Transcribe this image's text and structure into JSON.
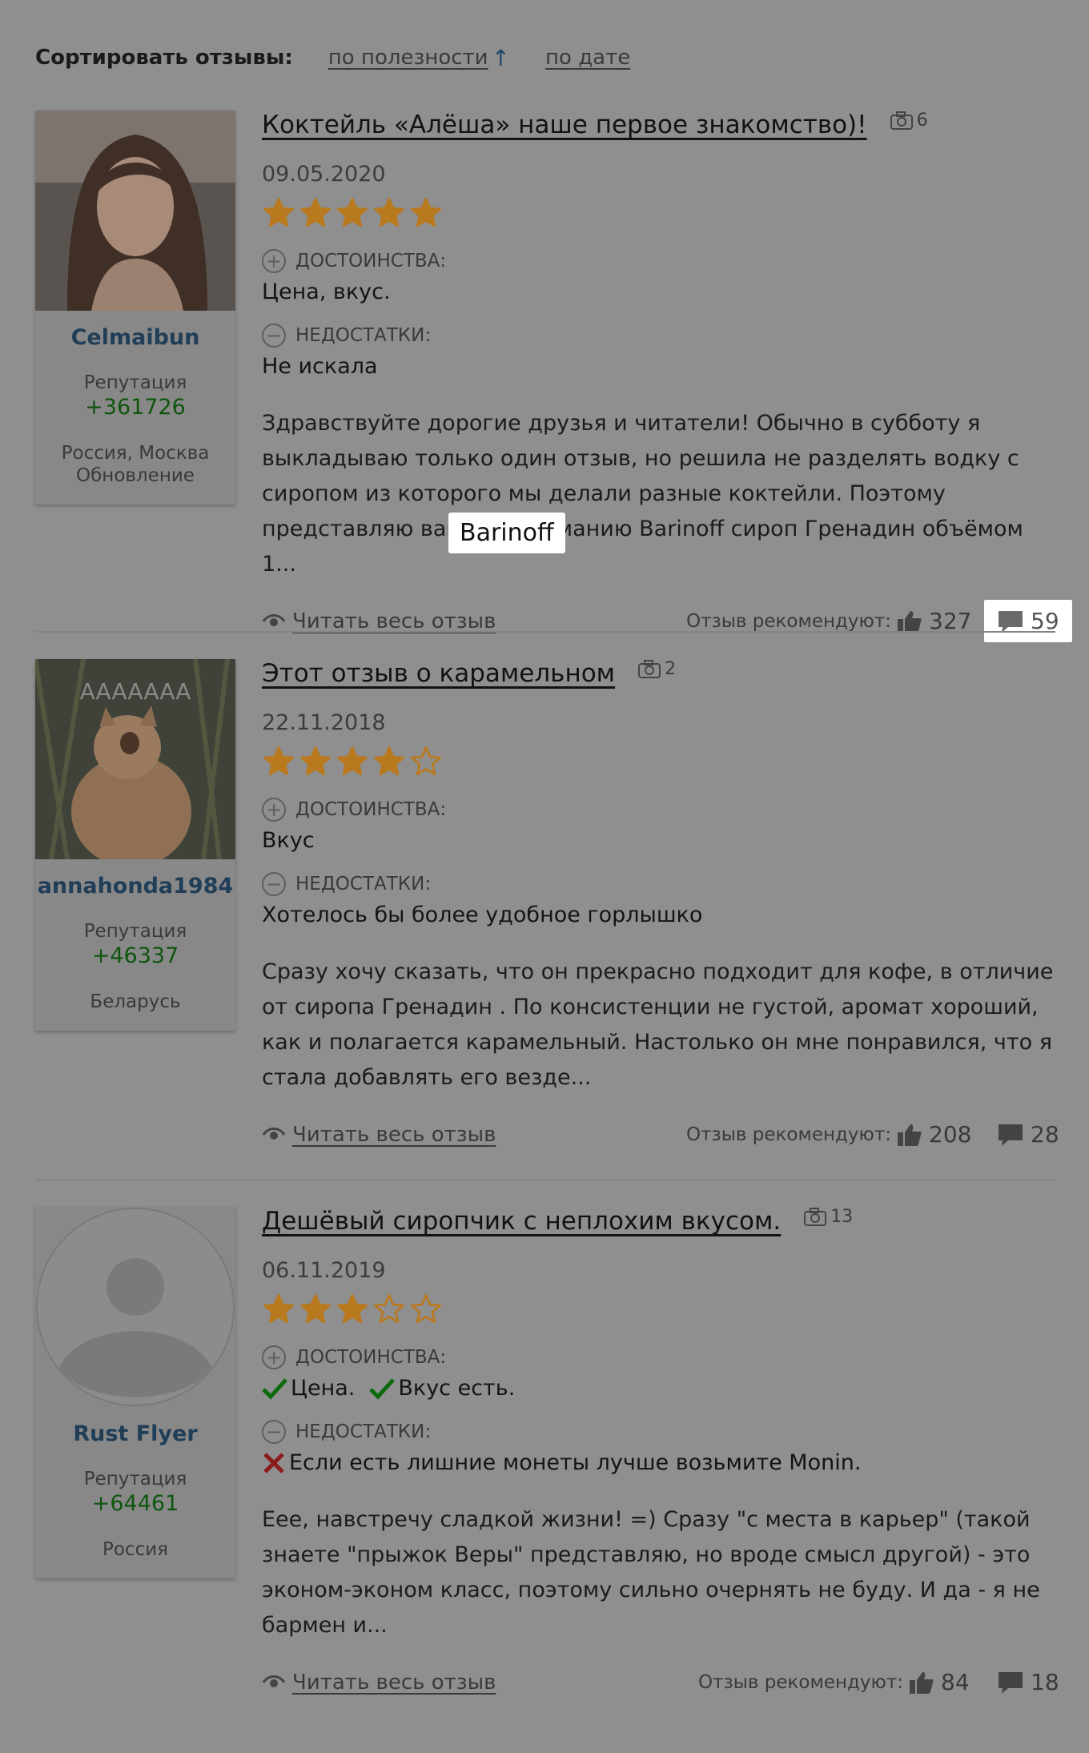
{
  "sort": {
    "label": "Сортировать отзывы:",
    "by_usefulness": "по полезности",
    "by_usefulness_arrow": "↑",
    "by_date": "по дате"
  },
  "tooltip": "Barinoff",
  "labels": {
    "pros": "ДОСТОИНСТВА:",
    "cons": "НЕДОСТАТКИ:",
    "read_more": "Читать весь отзыв",
    "recommend": "Отзыв рекомендуют:",
    "reputation": "Репутация"
  },
  "reviews": [
    {
      "user": {
        "name": "Celmaibun",
        "reputation": "+361726",
        "location": "Россия, Москва",
        "location_extra": "Обновление"
      },
      "title": "Коктейль «Алёша» наше первое знакомство)!",
      "photos": "6",
      "date": "09.05.2020",
      "rating": 5,
      "pros": "Цена, вкус.",
      "cons": "Не искала",
      "body": "Здравствуйте дорогие друзья и читатели! Обычно в субботу я выкладываю только один отзыв, но решила не разделять водку с сиропом из которого мы делали разные коктейли. Поэтому представляю вашему вниманию Barinoff сироп Гренадин объёмом 1...",
      "likes": "327",
      "comments": "59"
    },
    {
      "user": {
        "name": "annahonda1984",
        "reputation": "+46337",
        "location": "Беларусь"
      },
      "title": "Этот отзыв о карамельном",
      "photos": "2",
      "date": "22.11.2018",
      "rating": 4,
      "pros": "Вкус",
      "cons": "Хотелось бы более удобное горлышко",
      "body": "Сразу хочу сказать, что он прекрасно подходит для кофе, в отличие от сиропа Гренадин . По консистенции не густой, аромат хороший, как и полагается карамельный. Настолько он мне понравился, что я стала добавлять его везде...",
      "likes": "208",
      "comments": "28"
    },
    {
      "user": {
        "name": "Rust Flyer",
        "reputation": "+64461",
        "location": "Россия"
      },
      "title": "Дешёвый сиропчик с неплохим вкусом.",
      "photos": "13",
      "date": "06.11.2019",
      "rating": 3,
      "pros_items": [
        "Цена.",
        "Вкус есть."
      ],
      "cons": "Если есть лишние монеты лучше возьмите Monin.",
      "body": "Еее, навстречу сладкой жизни! =) Сразу \"с места в карьер\" (такой знаете \"прыжок Веры\" представляю, но вроде смысл другой) - это эконом-эконом класс, поэтому сильно очернять не буду. И да - я не бармен и...",
      "likes": "84",
      "comments": "18"
    }
  ],
  "colors": {
    "star": "#b8791f",
    "name": "#203e57",
    "reputation": "#0e560e",
    "background": "#8f8f8f"
  }
}
